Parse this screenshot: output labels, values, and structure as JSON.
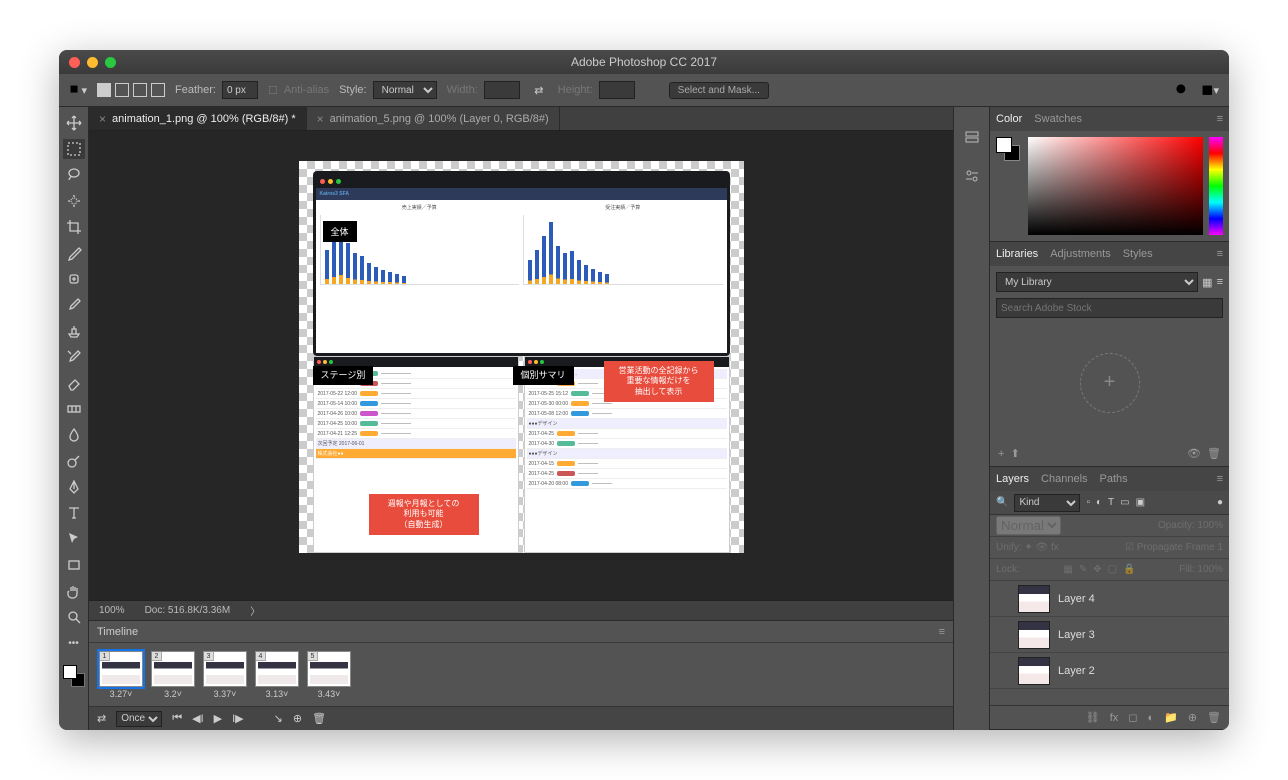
{
  "title": "Adobe Photoshop CC 2017",
  "optionbar": {
    "feather_label": "Feather:",
    "feather_value": "0 px",
    "antialias_label": "Anti-alias",
    "style_label": "Style:",
    "style_value": "Normal",
    "width_label": "Width:",
    "height_label": "Height:",
    "select_mask": "Select and Mask..."
  },
  "tabs": [
    {
      "label": "animation_1.png @ 100% (RGB/8#) *",
      "active": true
    },
    {
      "label": "animation_5.png @ 100% (Layer 0, RGB/8#)",
      "active": false
    }
  ],
  "status": {
    "zoom": "100%",
    "doc": "Doc: 516.8K/3.36M"
  },
  "timeline": {
    "title": "Timeline",
    "frames": [
      {
        "n": "1",
        "dur": "3.27"
      },
      {
        "n": "2",
        "dur": "3.2"
      },
      {
        "n": "3",
        "dur": "3.37"
      },
      {
        "n": "4",
        "dur": "3.13"
      },
      {
        "n": "5",
        "dur": "3.43"
      }
    ],
    "loop": "Once"
  },
  "color_tabs": {
    "color": "Color",
    "swatches": "Swatches"
  },
  "libraries": {
    "tab_lib": "Libraries",
    "tab_adj": "Adjustments",
    "tab_sty": "Styles",
    "selected": "My Library",
    "search_placeholder": "Search Adobe Stock"
  },
  "layers": {
    "tab_layers": "Layers",
    "tab_channels": "Channels",
    "tab_paths": "Paths",
    "kind": "Kind",
    "blend": "Normal",
    "opacity_label": "Opacity:",
    "opacity": "100%",
    "unify": "Unify:",
    "propagate": "Propagate Frame 1",
    "lock_label": "Lock:",
    "fill_label": "Fill:",
    "fill": "100%",
    "items": [
      {
        "name": "Layer 4"
      },
      {
        "name": "Layer 3"
      },
      {
        "name": "Layer 2"
      }
    ]
  },
  "canvas": {
    "callout_overall": "全体",
    "callout_stage": "ステージ別",
    "callout_summary": "個別サマリ",
    "chart1_title": "売上実績／予算",
    "chart2_title": "受注実績／予算",
    "red1_l1": "営業活動の全記録から",
    "red1_l2": "重要な情報だけを",
    "red1_l3": "抽出して表示",
    "red2_l1": "週報や月報としての",
    "red2_l2": "利用も可能",
    "red2_l3": "（自動生成）"
  }
}
